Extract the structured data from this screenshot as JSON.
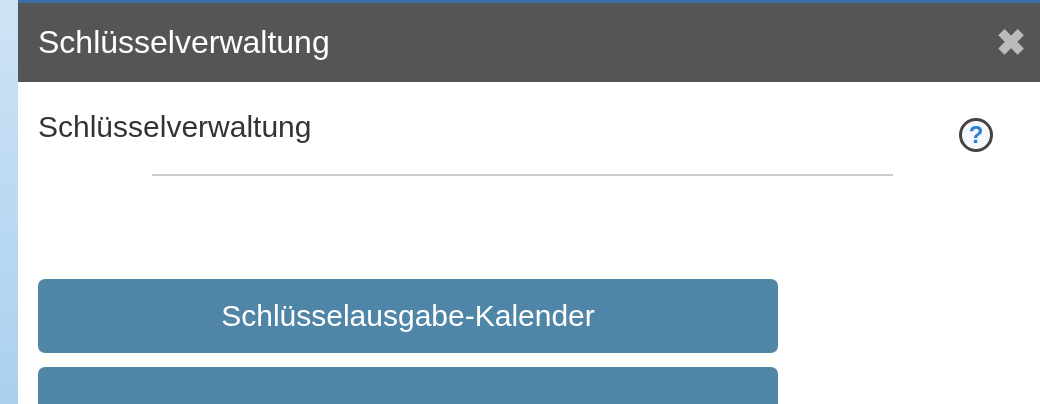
{
  "window": {
    "title": "Schlüsselverwaltung",
    "close": "✖"
  },
  "heading": "Schlüsselverwaltung",
  "help": "?",
  "buttons": [
    {
      "kind": "labelled",
      "label": "Schlüsselausgabe-Kalender"
    },
    {
      "kind": "cut"
    }
  ]
}
